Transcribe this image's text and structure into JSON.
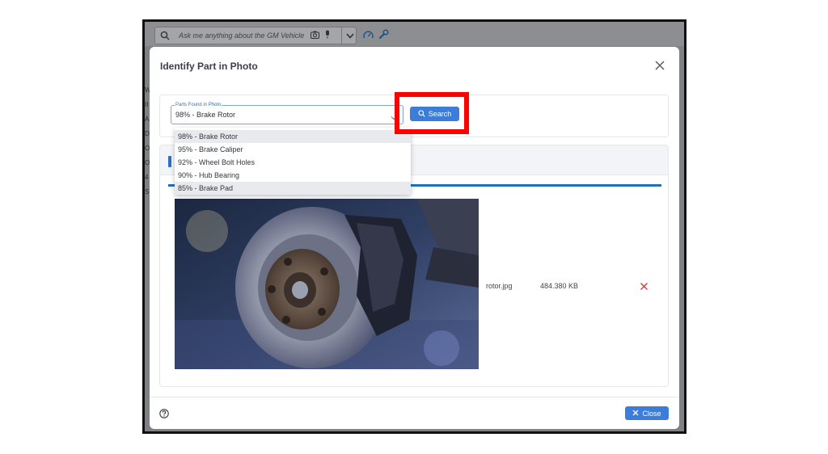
{
  "app": {
    "search_placeholder": "Ask me anything about the GM Vehicle",
    "side_letters": [
      "W",
      "II",
      "AS",
      "D",
      "O",
      "O",
      "4",
      "S"
    ]
  },
  "dialog": {
    "title": "Identify Part in Photo",
    "field_label": "Parts Found in Photo",
    "field_value": "98% - Brake Rotor",
    "search_label": "Search",
    "options": [
      "98% - Brake Rotor",
      "95% - Brake Caliper",
      "92% - Wheel Bolt Holes",
      "90% - Hub Bearing",
      "85% - Brake Pad"
    ],
    "selected_index": 0,
    "upload_progress": 1.0,
    "file": {
      "name": "rotor.jpg",
      "size": "484.380 KB"
    },
    "close_label": "Close"
  },
  "colors": {
    "accent": "#3b7dd8",
    "highlight": "#ff0000",
    "delete": "#e03a3a"
  }
}
